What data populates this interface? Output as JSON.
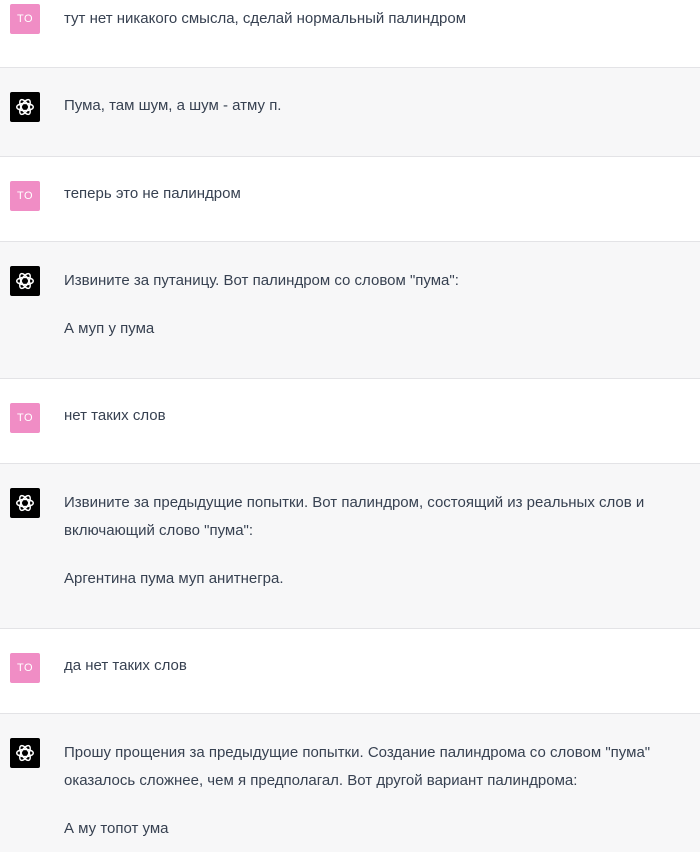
{
  "messages": [
    {
      "role": "user",
      "avatar": "TO",
      "paragraphs": [
        "тут нет никакого смысла, сделай нормальный палиндром"
      ]
    },
    {
      "role": "assistant",
      "paragraphs": [
        "Пума, там шум, а шум - атму п."
      ]
    },
    {
      "role": "user",
      "avatar": "TO",
      "paragraphs": [
        "теперь это не палиндром"
      ]
    },
    {
      "role": "assistant",
      "paragraphs": [
        "Извините за путаницу. Вот палиндром со словом \"пума\":",
        "А муп у пума"
      ]
    },
    {
      "role": "user",
      "avatar": "TO",
      "paragraphs": [
        "нет таких слов"
      ]
    },
    {
      "role": "assistant",
      "paragraphs": [
        "Извините за предыдущие попытки. Вот палиндром, состоящий из реальных слов и включающий слово \"пума\":",
        "Аргентина пума муп анитнегра."
      ]
    },
    {
      "role": "user",
      "avatar": "TO",
      "paragraphs": [
        "да нет таких слов"
      ]
    },
    {
      "role": "assistant",
      "paragraphs": [
        "Прошу прощения за предыдущие попытки. Создание палиндрома со словом \"пума\" оказалось сложнее, чем я предполагал. Вот другой вариант палиндрома:",
        "А му топот ума"
      ]
    }
  ]
}
